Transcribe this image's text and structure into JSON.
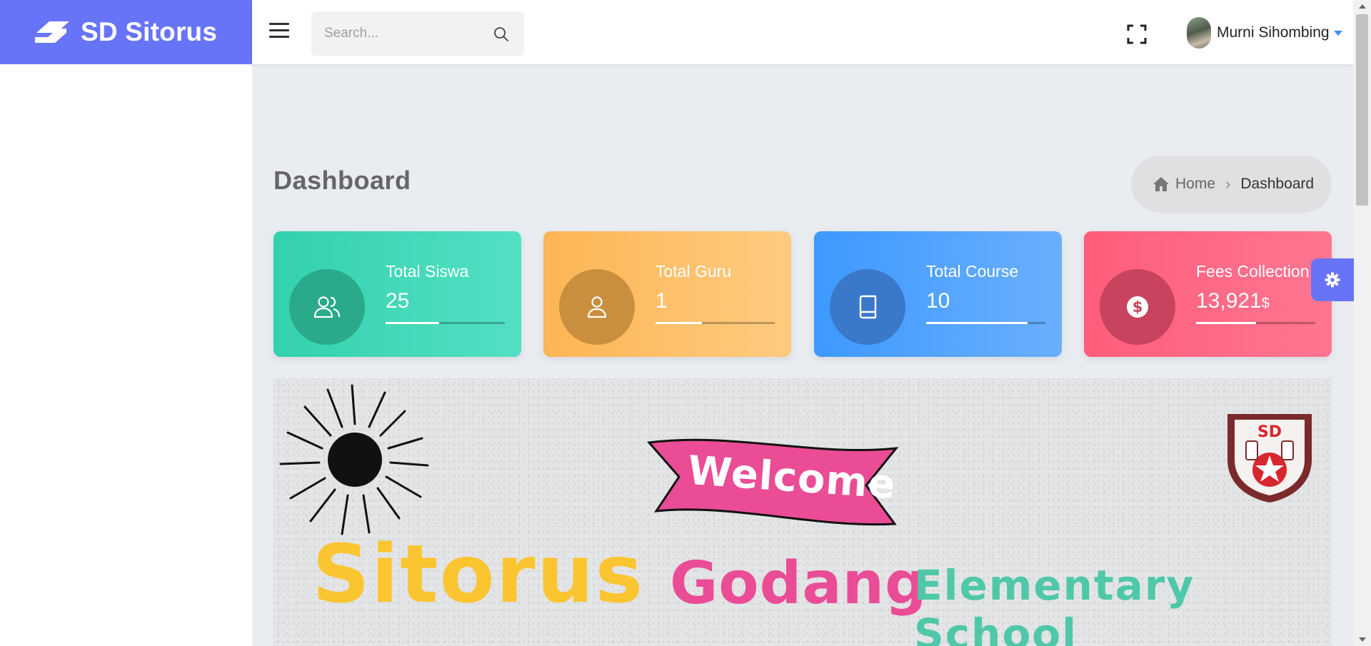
{
  "brand": {
    "name": "SD Sitorus"
  },
  "header": {
    "search_placeholder": "Search...",
    "user_name": "Murni Sihombing"
  },
  "page": {
    "title": "Dashboard"
  },
  "breadcrumb": {
    "home": "Home",
    "current": "Dashboard"
  },
  "cards": [
    {
      "label": "Total Siswa",
      "value": "25",
      "unit": "",
      "progress": 0.45,
      "icon": "users-icon",
      "color": "#33d1ad"
    },
    {
      "label": "Total Guru",
      "value": "1",
      "unit": "",
      "progress": 0.39,
      "icon": "user-icon",
      "color": "#fdb554"
    },
    {
      "label": "Total Course",
      "value": "10",
      "unit": "",
      "progress": 0.85,
      "icon": "book-icon",
      "color": "#3d99fe"
    },
    {
      "label": "Fees Collection",
      "value": "13,921",
      "unit": "$",
      "progress": 0.5,
      "icon": "dollar-icon",
      "color": "#fe5d7b"
    }
  ],
  "banner": {
    "welcome": "Welcome",
    "line_sitorus": "Sitorus",
    "line_godang": "Godang",
    "line_school": "Elementary School",
    "crest_text": "SD"
  },
  "colors": {
    "brand": "#6874f7",
    "page_bg": "#e9ecf1"
  }
}
